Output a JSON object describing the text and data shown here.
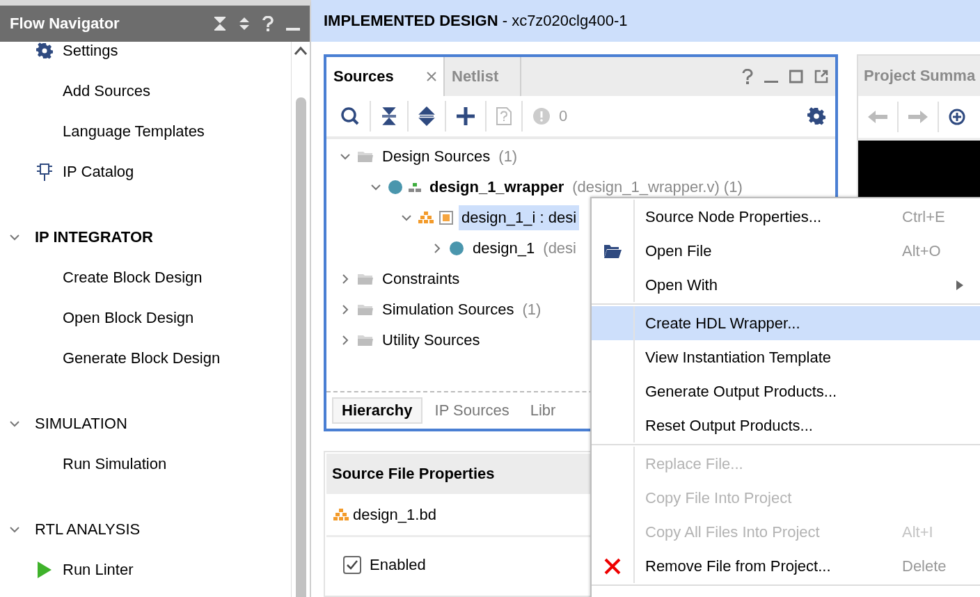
{
  "flow_navigator": {
    "title": "Flow Navigator",
    "sections": [
      {
        "items": [
          {
            "label": "Settings",
            "kind": "gear"
          },
          {
            "label": "Add Sources",
            "kind": "plain"
          },
          {
            "label": "Language Templates",
            "kind": "plain"
          },
          {
            "label": "IP Catalog",
            "kind": "catalog"
          }
        ]
      },
      {
        "heading": "IP INTEGRATOR",
        "active": true,
        "expanded": true,
        "items": [
          {
            "label": "Create Block Design",
            "kind": "plain"
          },
          {
            "label": "Open Block Design",
            "kind": "plain"
          },
          {
            "label": "Generate Block Design",
            "kind": "plain"
          }
        ]
      },
      {
        "heading": "SIMULATION",
        "active": false,
        "expanded": true,
        "items": [
          {
            "label": "Run Simulation",
            "kind": "plain"
          }
        ]
      },
      {
        "heading": "RTL ANALYSIS",
        "active": false,
        "expanded": true,
        "items": [
          {
            "label": "Run Linter",
            "kind": "run"
          }
        ]
      }
    ]
  },
  "design_header": {
    "title": "IMPLEMENTED DESIGN",
    "part": " - xc7z020clg400-1"
  },
  "sources_panel": {
    "tabs": [
      {
        "label": "Sources",
        "selected": true
      },
      {
        "label": "Netlist",
        "selected": false
      }
    ],
    "message_count": "0",
    "tree": [
      {
        "label": "Design Sources",
        "detail": "(1)",
        "kind": "folder",
        "expanded": true,
        "selected": false,
        "children": [
          {
            "label": "design_1_wrapper",
            "detail": "(design_1_wrapper.v) (1)",
            "kind": "top",
            "bold": true,
            "expanded": true,
            "selected": false,
            "children": [
              {
                "label": "design_1_i : desi",
                "kind": "bd",
                "expanded": true,
                "selected": true,
                "children": [
                  {
                    "label": "design_1",
                    "detail": "(desi",
                    "kind": "module",
                    "expanded": false,
                    "selected": false
                  }
                ]
              }
            ]
          }
        ]
      },
      {
        "label": "Constraints",
        "kind": "folder",
        "expanded": false,
        "selected": false
      },
      {
        "label": "Simulation Sources",
        "detail": "(1)",
        "kind": "folder",
        "expanded": false,
        "selected": false
      },
      {
        "label": "Utility Sources",
        "kind": "folder",
        "expanded": false,
        "selected": false
      }
    ],
    "bottom_tabs": [
      {
        "label": "Hierarchy",
        "selected": true
      },
      {
        "label": "IP Sources",
        "selected": false
      },
      {
        "label": "Libr",
        "selected": false
      }
    ]
  },
  "file_properties": {
    "title": "Source File Properties",
    "file": "design_1.bd",
    "enabled": {
      "label": "Enabled",
      "checked": true
    }
  },
  "project_summary": {
    "title": "Project Summa"
  },
  "context_menu": {
    "groups": [
      [
        {
          "label": "Source Node Properties...",
          "shortcut": "Ctrl+E",
          "kind": "plain",
          "disabled": false,
          "selected": false
        },
        {
          "label": "Open File",
          "shortcut": "Alt+O",
          "kind": "folder",
          "disabled": false,
          "selected": false
        },
        {
          "label": "Open With",
          "kind": "submenu",
          "disabled": false,
          "selected": false
        }
      ],
      [
        {
          "label": "Create HDL Wrapper...",
          "kind": "plain",
          "disabled": false,
          "selected": true
        },
        {
          "label": "View Instantiation Template",
          "kind": "plain",
          "disabled": false,
          "selected": false
        },
        {
          "label": "Generate Output Products...",
          "kind": "plain",
          "disabled": false,
          "selected": false
        },
        {
          "label": "Reset Output Products...",
          "kind": "plain",
          "disabled": false,
          "selected": false
        }
      ],
      [
        {
          "label": "Replace File...",
          "kind": "plain",
          "disabled": true,
          "selected": false
        },
        {
          "label": "Copy File Into Project",
          "kind": "plain",
          "disabled": true,
          "selected": false
        },
        {
          "label": "Copy All Files Into Project",
          "shortcut": "Alt+I",
          "kind": "plain",
          "disabled": true,
          "selected": false
        },
        {
          "label": "Remove File from Project...",
          "shortcut": "Delete",
          "kind": "remove",
          "disabled": false,
          "selected": false
        }
      ]
    ]
  }
}
